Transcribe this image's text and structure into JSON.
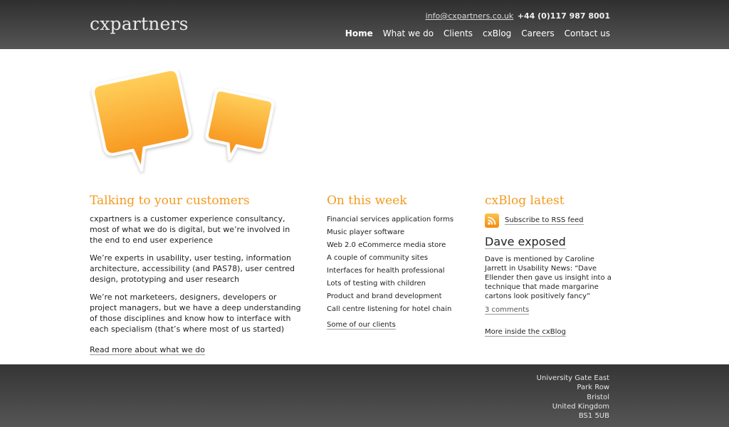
{
  "header": {
    "logo": "cxpartners",
    "email": "info@cxpartners.co.uk",
    "phone": "+44 (0)117 987 8001",
    "nav": [
      {
        "label": "Home",
        "active": true
      },
      {
        "label": "What we do"
      },
      {
        "label": "Clients"
      },
      {
        "label": "cxBlog"
      },
      {
        "label": "Careers"
      },
      {
        "label": "Contact us"
      }
    ]
  },
  "intro": {
    "heading": "Talking to your customers",
    "paragraphs": [
      "cxpartners is a customer experience consultancy, most of what we do is digital, but we’re involved in the end to end user experience",
      "We’re experts in usability, user testing, information architecture, accessibility (and PAS78), user centred design, prototyping and user research",
      "We’re not marketeers, designers, developers or project managers, but we have a deep understanding of those disciplines and know how to interface with each specialism (that’s where most of us started)"
    ],
    "more_link": "Read more about what we do"
  },
  "this_week": {
    "heading": "On this week",
    "items": [
      "Financial services application forms",
      "Music player software",
      "Web 2.0 eCommerce media store",
      "A couple of community sites",
      "Interfaces for health professional",
      "Lots of testing with children",
      "Product and brand development",
      "Call centre listening for hotel chain"
    ],
    "more_link": "Some of our clients"
  },
  "blog": {
    "heading": "cxBlog latest",
    "rss_label": "Subscribe to RSS feed",
    "post_title": "Dave exposed",
    "post_body": "Dave is mentioned by Caroline Jarrett in Usability News: “Dave Ellender then gave us insight into a technique that made margarine cartons look positively fancy”",
    "comments": "3 comments",
    "more_link": "More inside the cxBlog"
  },
  "footer": {
    "address": [
      "University Gate East",
      "Park Row",
      "Bristol",
      "United Kingdom",
      "BS1 5UB"
    ]
  },
  "colors": {
    "accent": "#f39a1e",
    "header_bg": "#3a3a3a",
    "bubble_orange": "#f7a21c"
  },
  "icons": {
    "rss": "rss-feed-icon",
    "bubbles": "speech-bubbles-graphic"
  }
}
